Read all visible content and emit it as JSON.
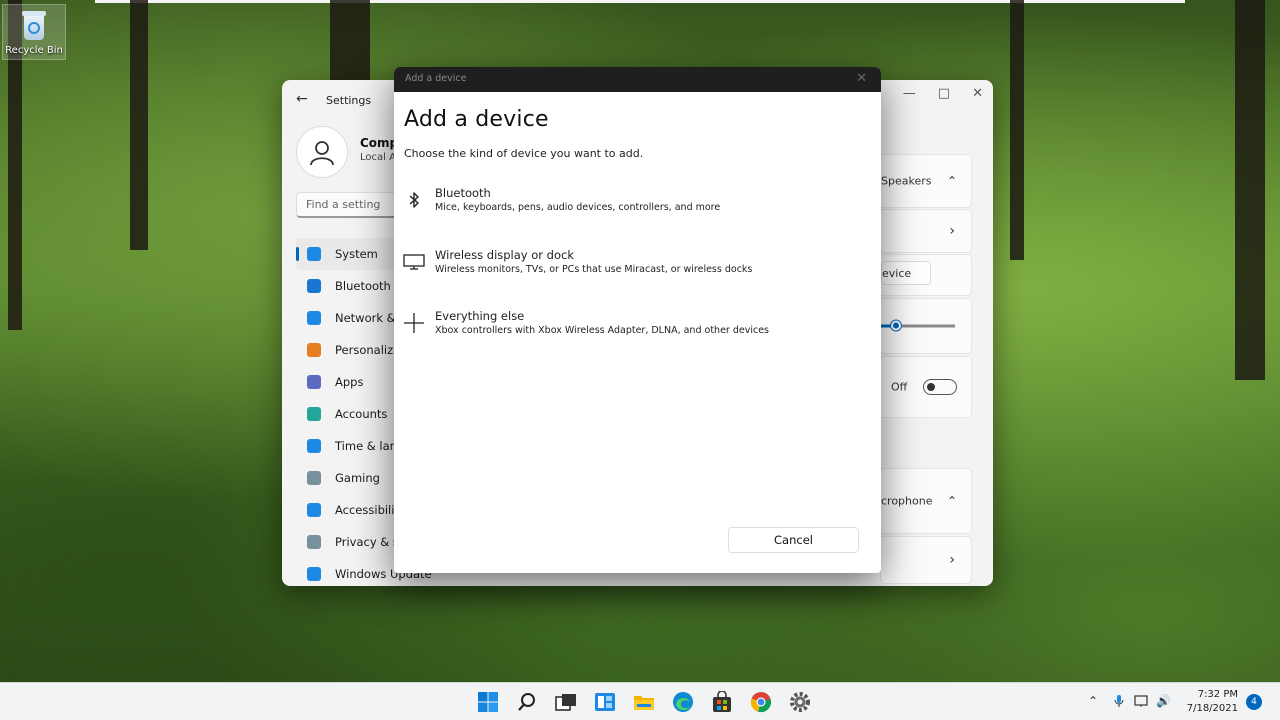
{
  "desktop": {
    "recycle_bin_label": "Recycle Bin"
  },
  "settings_window": {
    "title": "Settings",
    "account_name": "Comp",
    "account_sub": "Local A",
    "search_placeholder": "Find a setting",
    "nav": [
      {
        "label": "System",
        "icon": "monitor-icon",
        "color": "#1e88e5",
        "active": true
      },
      {
        "label": "Bluetooth",
        "icon": "bluetooth-icon",
        "color": "#1976d2",
        "active": false
      },
      {
        "label": "Network &",
        "icon": "wifi-icon",
        "color": "#1e88e5",
        "active": false
      },
      {
        "label": "Personaliza",
        "icon": "brush-icon",
        "color": "#e67e22",
        "active": false
      },
      {
        "label": "Apps",
        "icon": "apps-icon",
        "color": "#5c6bc0",
        "active": false
      },
      {
        "label": "Accounts",
        "icon": "person-icon",
        "color": "#26a69a",
        "active": false
      },
      {
        "label": "Time & lan",
        "icon": "clock-globe-icon",
        "color": "#1e88e5",
        "active": false
      },
      {
        "label": "Gaming",
        "icon": "gamepad-icon",
        "color": "#78909c",
        "active": false
      },
      {
        "label": "Accessibili",
        "icon": "accessibility-icon",
        "color": "#1e88e5",
        "active": false
      },
      {
        "label": "Privacy & s",
        "icon": "shield-icon",
        "color": "#78909c",
        "active": false
      },
      {
        "label": "Windows Update",
        "icon": "update-icon",
        "color": "#1e88e5",
        "active": false
      }
    ],
    "right_panel": {
      "speakers_label": "Speakers",
      "add_device_partial": "evice",
      "volume_fraction": 0.2,
      "toggle_label": "Off",
      "microphone_label": "crophone"
    }
  },
  "dialog": {
    "titlebar": "Add a device",
    "heading": "Add a device",
    "subtitle": "Choose the kind of device you want to add.",
    "options": [
      {
        "name": "Bluetooth",
        "desc": "Mice, keyboards, pens, audio devices, controllers, and more",
        "icon": "bluetooth-icon"
      },
      {
        "name": "Wireless display or dock",
        "desc": "Wireless monitors, TVs, or PCs that use Miracast, or wireless docks",
        "icon": "monitor-icon"
      },
      {
        "name": "Everything else",
        "desc": "Xbox controllers with Xbox Wireless Adapter, DLNA, and other devices",
        "icon": "plus-icon"
      }
    ],
    "cancel_label": "Cancel"
  },
  "taskbar": {
    "apps": [
      "start-icon",
      "search-icon",
      "task-view-icon",
      "widgets-icon",
      "file-explorer-icon",
      "edge-icon",
      "store-icon",
      "chrome-icon",
      "settings-gear-icon"
    ],
    "time": "7:32 PM",
    "date": "7/18/2021",
    "notification_count": "4"
  }
}
